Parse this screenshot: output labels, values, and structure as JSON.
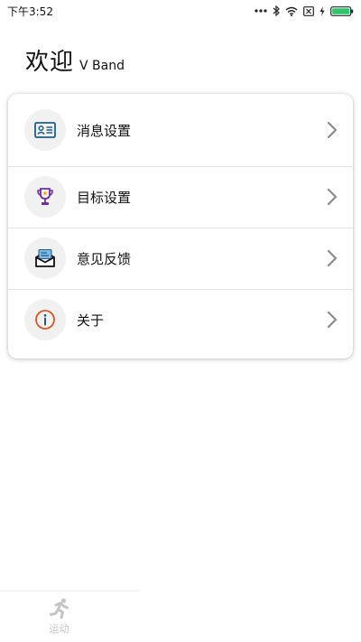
{
  "status_bar": {
    "time": "下午3:52",
    "icons": [
      "more-dots-icon",
      "bluetooth-icon",
      "wifi-icon",
      "sim-off-icon",
      "charging-icon",
      "battery-icon"
    ]
  },
  "header": {
    "welcome": "欢迎",
    "device": "V Band"
  },
  "menu": {
    "items": [
      {
        "label": "消息设置",
        "icon": "contact-card-icon"
      },
      {
        "label": "目标设置",
        "icon": "trophy-icon"
      },
      {
        "label": "意见反馈",
        "icon": "mail-icon"
      },
      {
        "label": "关于",
        "icon": "info-icon"
      }
    ]
  },
  "bottom_nav": {
    "tabs": [
      {
        "label": "运动",
        "icon": "running-icon"
      }
    ]
  },
  "colors": {
    "card_icon_blue": "#1f5f8b",
    "trophy_purple": "#6a2fa0",
    "trophy_gold": "#f2a900",
    "info_orange": "#d8572a",
    "tab_inactive": "#c4c4c4"
  }
}
